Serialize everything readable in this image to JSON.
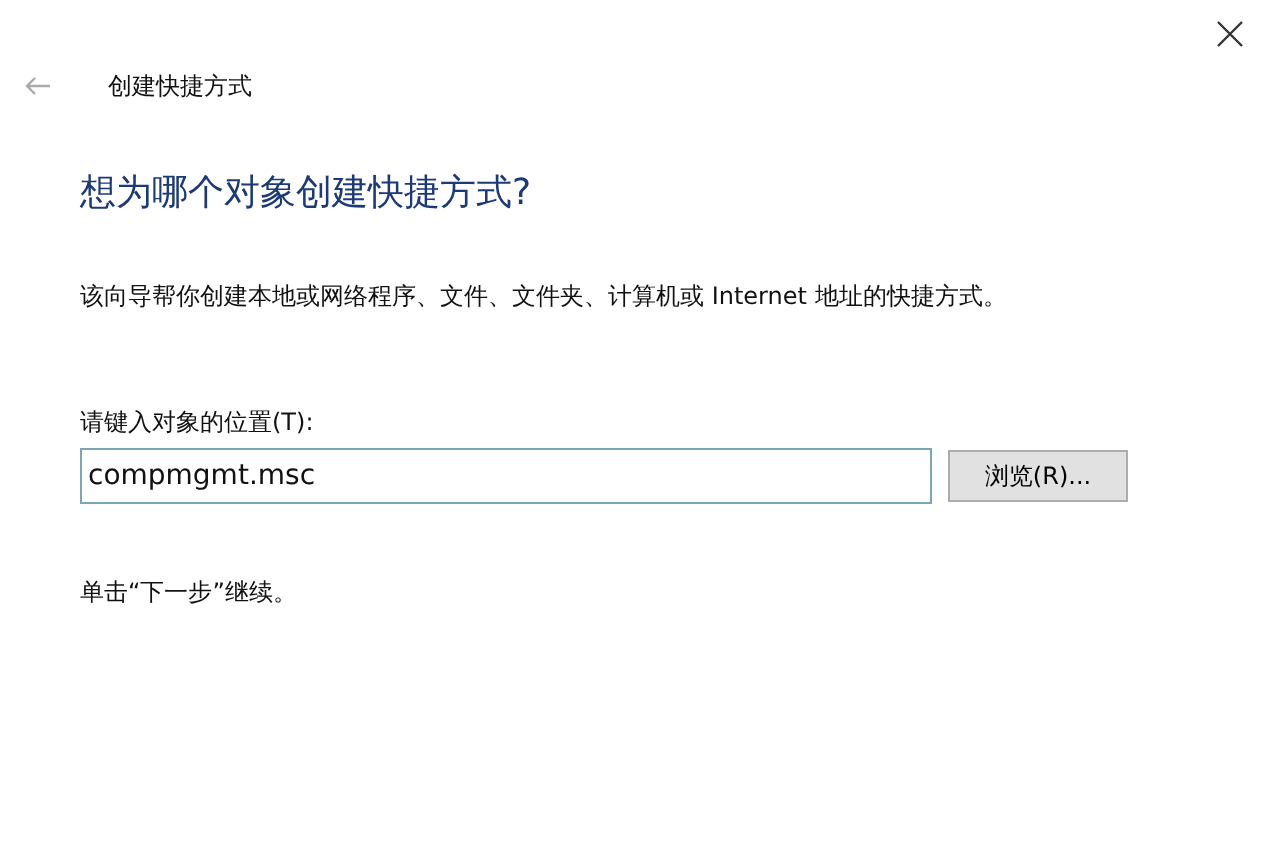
{
  "window": {
    "title": "创建快捷方式"
  },
  "back": {
    "disabled": true
  },
  "heading": "想为哪个对象创建快捷方式?",
  "description": "该向导帮你创建本地或网络程序、文件、文件夹、计算机或 Internet 地址的快捷方式。",
  "location": {
    "label": "请键入对象的位置(T):",
    "value": "compmgmt.msc",
    "browse": "浏览(R)..."
  },
  "hint": "单击“下一步”继续。"
}
